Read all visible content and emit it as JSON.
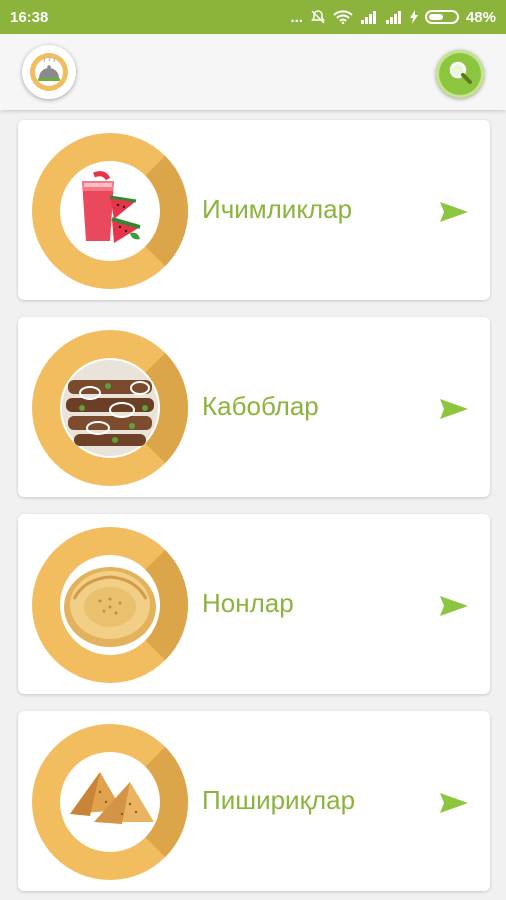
{
  "status": {
    "time": "16:38",
    "dots": "...",
    "battery": "48%"
  },
  "appbar": {
    "logo_icon": "chef-cloche-logo-icon",
    "search_icon": "magnifier-icon"
  },
  "categories": [
    {
      "label": "Ичимликлар",
      "image": "drink-watermelon-image"
    },
    {
      "label": "Кабоблар",
      "image": "kebab-plate-image"
    },
    {
      "label": "Нонлар",
      "image": "bread-image"
    },
    {
      "label": "Пишириқлар",
      "image": "samsa-pastry-image"
    }
  ],
  "colors": {
    "accent": "#8cb33c",
    "ring": "#f2bd5f",
    "statusbar": "#8cb33c"
  }
}
